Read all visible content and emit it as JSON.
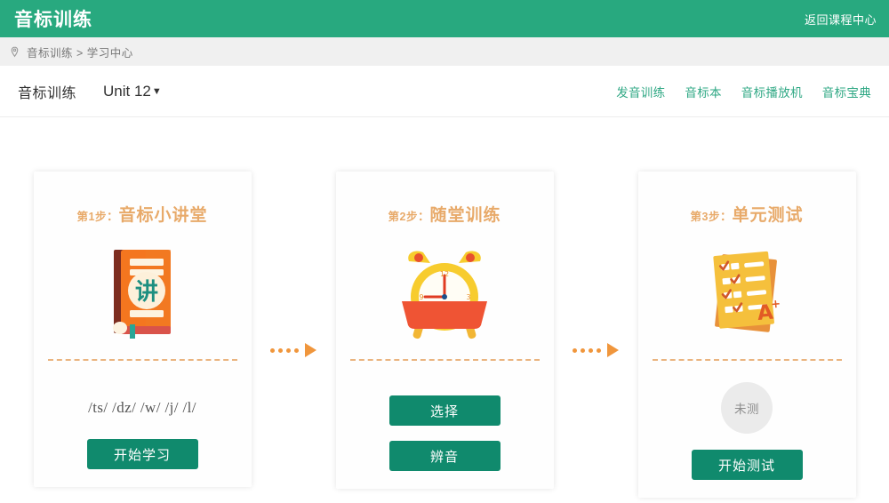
{
  "topbar": {
    "title": "音标训练",
    "back_link": "返回课程中心"
  },
  "breadcrumb": {
    "icon": "location-pin-icon",
    "text": "音标训练 > 学习中心"
  },
  "subnav": {
    "brand": "音标训练",
    "unit_label": "Unit 12",
    "unit_caret": "▼",
    "links": [
      {
        "label": "发音训练"
      },
      {
        "label": "音标本"
      },
      {
        "label": "音标播放机"
      },
      {
        "label": "音标宝典"
      }
    ]
  },
  "cards": [
    {
      "step": "第1步",
      "sep": "：",
      "name": "音标小讲堂",
      "icon": "orange-book-icon",
      "icon_char": "讲",
      "phonetics": "/ts/ /dz/ /w/ /j/ /l/",
      "buttons": [
        {
          "label": "开始学习"
        }
      ]
    },
    {
      "step": "第2步",
      "sep": "：",
      "name": "随堂训练",
      "icon": "alarm-clock-icon",
      "clock_labels": {
        "twelve": "12",
        "three": "3",
        "nine": "9"
      },
      "buttons": [
        {
          "label": "选择"
        },
        {
          "label": "辨音"
        }
      ]
    },
    {
      "step": "第3步",
      "sep": "：",
      "name": "单元测试",
      "icon": "test-paper-icon",
      "grade_mark": "A",
      "grade_plus": "+",
      "status_badge": "未测",
      "buttons": [
        {
          "label": "开始测试"
        }
      ]
    }
  ],
  "colors": {
    "header_green": "#28a97f",
    "button_green": "#108a6d",
    "link_green": "#2fa884",
    "title_orange": "#e8aa6a",
    "arrow_orange": "#f0963c",
    "page_bg": "#f0f0f0"
  }
}
